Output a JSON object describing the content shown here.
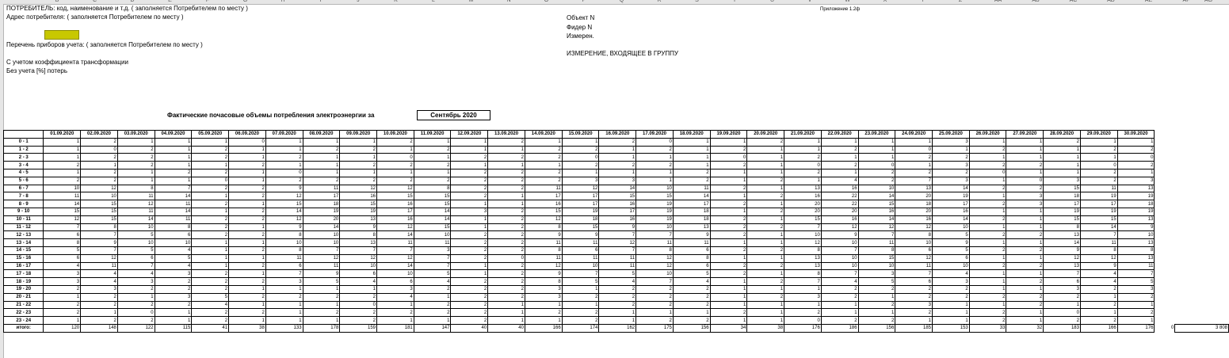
{
  "sheet": {
    "column_letters": [
      "B",
      "C",
      "D",
      "E",
      "F",
      "G",
      "H",
      "I",
      "J",
      "K",
      "L",
      "M",
      "N",
      "O",
      "P",
      "Q",
      "R",
      "S",
      "T",
      "U",
      "V",
      "W",
      "X",
      "Y",
      "Z",
      "AA",
      "AB",
      "AC",
      "AD",
      "AE",
      "AF",
      "AG"
    ]
  },
  "header": {
    "consumer_line": "ПОТРЕБИТЕЛЬ: код, наименование и т.д. ( заполняется Потребителем по месту )",
    "address_line": "Адрес потребителя: ( заполняется Потребителем по месту )",
    "appendix": "Приложение 1.2ф",
    "object_label": "Объект N",
    "feeder_label": "Фидер N",
    "measure_label": "Измерен.",
    "meters_line": "Перечень приборов учета: ( заполняется Потребителем по месту )",
    "group_line": "ИЗМЕРЕНИЕ, ВХОДЯЩЕЕ В ГРУППУ",
    "coef_line": "С учетом коэффициента трансформации",
    "loss_line": "Без учета [%] потерь"
  },
  "report": {
    "title": "Фактические почасовые объемы потребления электроэнергии за",
    "month": "Сентябрь 2020"
  },
  "table": {
    "dates": [
      "01.09.2020",
      "02.09.2020",
      "03.09.2020",
      "04.09.2020",
      "05.09.2020",
      "06.09.2020",
      "07.09.2020",
      "08.09.2020",
      "09.09.2020",
      "10.09.2020",
      "11.09.2020",
      "12.09.2020",
      "13.09.2020",
      "14.09.2020",
      "15.09.2020",
      "16.09.2020",
      "17.09.2020",
      "18.09.2020",
      "19.09.2020",
      "20.09.2020",
      "21.09.2020",
      "22.09.2020",
      "23.09.2020",
      "24.09.2020",
      "25.09.2020",
      "26.09.2020",
      "27.09.2020",
      "28.09.2020",
      "29.09.2020",
      "30.09.2020"
    ],
    "rows": [
      {
        "hour": "0 - 1",
        "values": [
          "1",
          "2",
          "1",
          "1",
          "1",
          "0",
          "1",
          "1",
          "1",
          "2",
          "1",
          "1",
          "2",
          "1",
          "1",
          "2",
          "0",
          "1",
          "1",
          "2",
          "1",
          "1",
          "1",
          "1",
          "3",
          "1",
          "1",
          "2",
          "1",
          "1"
        ]
      },
      {
        "hour": "1 - 2",
        "values": [
          "1",
          "0",
          "2",
          "1",
          "2",
          "1",
          "1",
          "2",
          "2",
          "1",
          "2",
          "1",
          "1",
          "2",
          "2",
          "1",
          "2",
          "1",
          "2",
          "1",
          "1",
          "2",
          "1",
          "0",
          "1",
          "2",
          "1",
          "1",
          "2",
          "2"
        ]
      },
      {
        "hour": "2 - 3",
        "values": [
          "1",
          "2",
          "2",
          "1",
          "2",
          "1",
          "2",
          "1",
          "1",
          "0",
          "1",
          "2",
          "2",
          "2",
          "0",
          "1",
          "1",
          "1",
          "0",
          "1",
          "2",
          "1",
          "1",
          "2",
          "2",
          "1",
          "1",
          "1",
          "1",
          "0"
        ]
      },
      {
        "hour": "3 - 4",
        "values": [
          "2",
          "1",
          "2",
          "1",
          "1",
          "2",
          "1",
          "1",
          "2",
          "2",
          "2",
          "1",
          "1",
          "1",
          "2",
          "2",
          "2",
          "1",
          "2",
          "1",
          "0",
          "2",
          "0",
          "1",
          "3",
          "2",
          "2",
          "1",
          "0",
          "2"
        ]
      },
      {
        "hour": "4 - 5",
        "values": [
          "1",
          "2",
          "1",
          "2",
          "2",
          "1",
          "0",
          "1",
          "1",
          "1",
          "1",
          "2",
          "2",
          "2",
          "1",
          "1",
          "1",
          "2",
          "1",
          "1",
          "2",
          "1",
          "2",
          "2",
          "2",
          "0",
          "1",
          "1",
          "2",
          "1"
        ]
      },
      {
        "hour": "5 - 6",
        "values": [
          "2",
          "2",
          "1",
          "1",
          "0",
          "1",
          "2",
          "2",
          "2",
          "2",
          "2",
          "2",
          "2",
          "2",
          "3",
          "3",
          "1",
          "2",
          "1",
          "2",
          "1",
          "4",
          "2",
          "7",
          "3",
          "1",
          "0",
          "3",
          "2",
          "3"
        ]
      },
      {
        "hour": "6 - 7",
        "values": [
          "10",
          "12",
          "8",
          "7",
          "2",
          "2",
          "9",
          "11",
          "12",
          "12",
          "8",
          "2",
          "2",
          "11",
          "12",
          "14",
          "10",
          "11",
          "2",
          "1",
          "13",
          "16",
          "10",
          "13",
          "14",
          "2",
          "2",
          "15",
          "11",
          "13"
        ]
      },
      {
        "hour": "7 - 8",
        "values": [
          "11",
          "10",
          "11",
          "14",
          "1",
          "2",
          "12",
          "17",
          "16",
          "15",
          "15",
          "2",
          "1",
          "17",
          "17",
          "15",
          "15",
          "14",
          "1",
          "2",
          "16",
          "22",
          "14",
          "20",
          "19",
          "1",
          "3",
          "18",
          "19",
          "19"
        ]
      },
      {
        "hour": "8 - 9",
        "values": [
          "14",
          "15",
          "12",
          "11",
          "2",
          "1",
          "15",
          "18",
          "15",
          "16",
          "15",
          "1",
          "1",
          "16",
          "17",
          "16",
          "19",
          "17",
          "2",
          "1",
          "20",
          "22",
          "15",
          "18",
          "17",
          "2",
          "3",
          "17",
          "17",
          "18"
        ]
      },
      {
        "hour": "9 - 10",
        "values": [
          "15",
          "15",
          "11",
          "14",
          "1",
          "2",
          "14",
          "19",
          "19",
          "17",
          "14",
          "3",
          "2",
          "15",
          "19",
          "17",
          "19",
          "18",
          "1",
          "2",
          "20",
          "20",
          "16",
          "20",
          "16",
          "1",
          "1",
          "19",
          "19",
          "19"
        ]
      },
      {
        "hour": "10 - 11",
        "values": [
          "12",
          "15",
          "14",
          "11",
          "2",
          "2",
          "12",
          "20",
          "13",
          "16",
          "14",
          "1",
          "2",
          "12",
          "18",
          "16",
          "19",
          "18",
          "2",
          "1",
          "15",
          "16",
          "14",
          "16",
          "14",
          "2",
          "1",
          "15",
          "15",
          "13"
        ]
      },
      {
        "hour": "11 - 12",
        "values": [
          "7",
          "8",
          "10",
          "8",
          "2",
          "1",
          "9",
          "14",
          "9",
          "12",
          "15",
          "1",
          "2",
          "8",
          "15",
          "9",
          "10",
          "13",
          "2",
          "2",
          "7",
          "12",
          "12",
          "12",
          "10",
          "1",
          "1",
          "8",
          "14",
          "9"
        ]
      },
      {
        "hour": "12 - 13",
        "values": [
          "6",
          "7",
          "5",
          "6",
          "2",
          "2",
          "8",
          "10",
          "8",
          "14",
          "10",
          "2",
          "2",
          "9",
          "9",
          "7",
          "7",
          "9",
          "2",
          "1",
          "10",
          "9",
          "7",
          "8",
          "5",
          "2",
          "2",
          "13",
          "7",
          "10"
        ]
      },
      {
        "hour": "13 - 14",
        "values": [
          "8",
          "9",
          "10",
          "10",
          "1",
          "1",
          "10",
          "10",
          "13",
          "11",
          "11",
          "2",
          "2",
          "11",
          "11",
          "12",
          "11",
          "11",
          "1",
          "1",
          "12",
          "10",
          "11",
          "10",
          "9",
          "1",
          "1",
          "14",
          "11",
          "13"
        ]
      },
      {
        "hour": "14 - 15",
        "values": [
          "5",
          "7",
          "5",
          "4",
          "1",
          "2",
          "8",
          "7",
          "7",
          "7",
          "3",
          "2",
          "2",
          "8",
          "6",
          "7",
          "8",
          "6",
          "2",
          "2",
          "8",
          "7",
          "8",
          "6",
          "5",
          "2",
          "2",
          "9",
          "8",
          "8"
        ]
      },
      {
        "hour": "15 - 16",
        "values": [
          "6",
          "12",
          "6",
          "5",
          "1",
          "1",
          "11",
          "12",
          "12",
          "12",
          "7",
          "2",
          "0",
          "11",
          "11",
          "11",
          "12",
          "8",
          "1",
          "1",
          "13",
          "10",
          "15",
          "12",
          "6",
          "1",
          "1",
          "12",
          "12",
          "13"
        ]
      },
      {
        "hour": "16 - 17",
        "values": [
          "4",
          "11",
          "7",
          "4",
          "1",
          "2",
          "6",
          "11",
          "10",
          "14",
          "7",
          "1",
          "2",
          "12",
          "10",
          "11",
          "12",
          "6",
          "2",
          "2",
          "13",
          "10",
          "10",
          "11",
          "10",
          "2",
          "2",
          "13",
          "9",
          "11"
        ]
      },
      {
        "hour": "17 - 18",
        "values": [
          "3",
          "4",
          "4",
          "3",
          "2",
          "1",
          "7",
          "9",
          "6",
          "10",
          "5",
          "1",
          "2",
          "9",
          "7",
          "5",
          "10",
          "5",
          "2",
          "1",
          "8",
          "7",
          "3",
          "7",
          "4",
          "1",
          "1",
          "7",
          "4",
          "7"
        ]
      },
      {
        "hour": "18 - 19",
        "values": [
          "3",
          "4",
          "3",
          "2",
          "2",
          "2",
          "3",
          "5",
          "4",
          "6",
          "4",
          "2",
          "2",
          "8",
          "5",
          "4",
          "7",
          "4",
          "1",
          "2",
          "7",
          "4",
          "5",
          "6",
          "3",
          "1",
          "2",
          "6",
          "4",
          "5"
        ]
      },
      {
        "hour": "19 - 20",
        "values": [
          "2",
          "3",
          "2",
          "2",
          "2",
          "1",
          "1",
          "1",
          "1",
          "3",
          "2",
          "2",
          "2",
          "3",
          "1",
          "2",
          "2",
          "2",
          "1",
          "1",
          "1",
          "2",
          "2",
          "2",
          "2",
          "1",
          "1",
          "3",
          "2",
          "3"
        ]
      },
      {
        "hour": "20 - 21",
        "values": [
          "1",
          "2",
          "1",
          "3",
          "5",
          "2",
          "2",
          "2",
          "2",
          "4",
          "1",
          "2",
          "2",
          "3",
          "2",
          "2",
          "2",
          "2",
          "1",
          "2",
          "3",
          "2",
          "1",
          "2",
          "2",
          "2",
          "2",
          "2",
          "1",
          "2"
        ]
      },
      {
        "hour": "21 - 22",
        "values": [
          "2",
          "2",
          "2",
          "2",
          "4",
          "1",
          "1",
          "1",
          "0",
          "1",
          "2",
          "2",
          "1",
          "1",
          "1",
          "2",
          "2",
          "2",
          "1",
          "1",
          "1",
          "1",
          "2",
          "3",
          "1",
          "1",
          "2",
          "1",
          "2",
          "1"
        ]
      },
      {
        "hour": "22 - 23",
        "values": [
          "2",
          "1",
          "0",
          "1",
          "2",
          "2",
          "1",
          "2",
          "2",
          "2",
          "2",
          "2",
          "1",
          "2",
          "2",
          "1",
          "1",
          "1",
          "2",
          "1",
          "2",
          "1",
          "1",
          "2",
          "1",
          "2",
          "1",
          "0",
          "1",
          "2"
        ]
      },
      {
        "hour": "23 - 24",
        "values": [
          "1",
          "2",
          "2",
          "1",
          "2",
          "1",
          "1",
          "1",
          "2",
          "1",
          "1",
          "2",
          "1",
          "1",
          "2",
          "1",
          "2",
          "2",
          "1",
          "1",
          "0",
          "2",
          "2",
          "1",
          "1",
          "2",
          "1",
          "2",
          "2",
          "1"
        ]
      }
    ],
    "total_label": "итого:",
    "totals": [
      "120",
      "148",
      "122",
      "115",
      "41",
      "38",
      "133",
      "178",
      "159",
      "181",
      "147",
      "40",
      "40",
      "166",
      "174",
      "162",
      "175",
      "156",
      "34",
      "38",
      "176",
      "186",
      "156",
      "185",
      "153",
      "33",
      "32",
      "183",
      "166",
      "176"
    ],
    "extra_total": "0",
    "grand_total": "3 808"
  }
}
